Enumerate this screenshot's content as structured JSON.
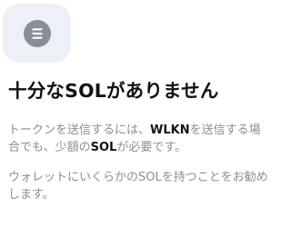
{
  "header": {
    "icon": "solana-icon",
    "icon_background": "#eef0f7",
    "icon_color": "#8a8d99"
  },
  "title": "十分なSOLがありません",
  "description": {
    "part1": "トークンを送信するには、",
    "token": "WLKN",
    "part2": "を送信する場合でも、少額の",
    "currency": "SOL",
    "part3": "が必要です。"
  },
  "hint": "ウォレットにいくらかのSOLを持つことをお勧めします。"
}
